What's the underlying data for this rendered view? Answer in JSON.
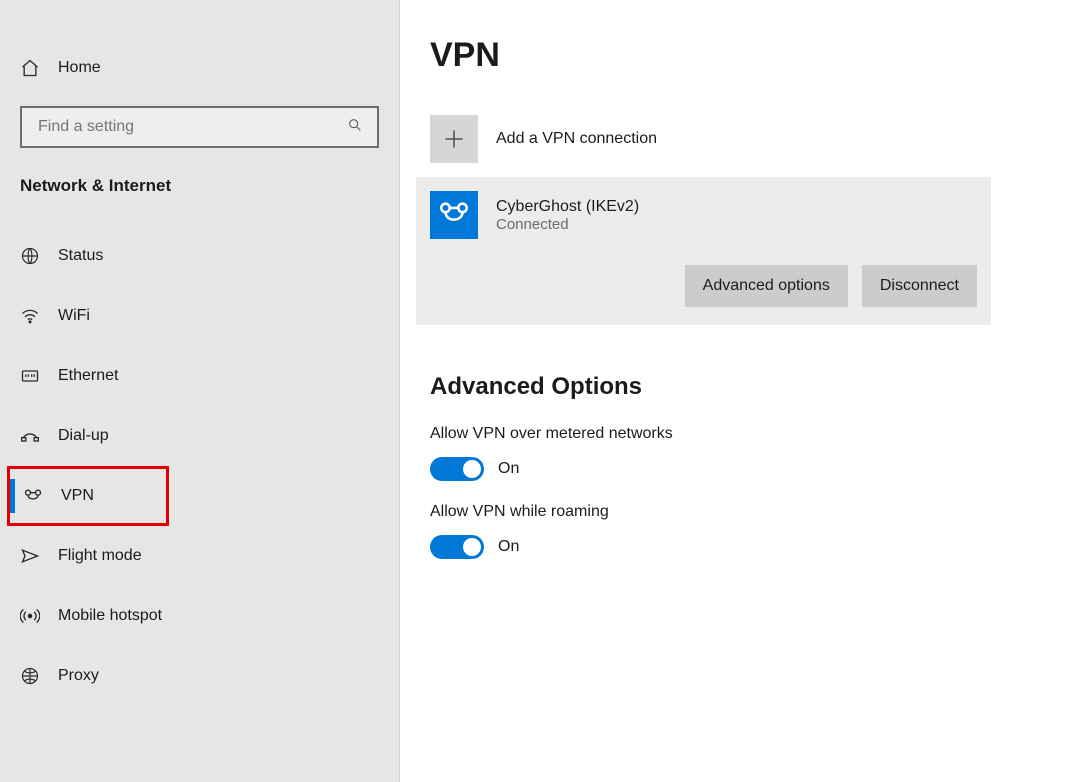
{
  "sidebar": {
    "home": "Home",
    "search_placeholder": "Find a setting",
    "category": "Network & Internet",
    "items": [
      {
        "label": "Status",
        "icon": "status"
      },
      {
        "label": "WiFi",
        "icon": "wifi"
      },
      {
        "label": "Ethernet",
        "icon": "ethernet"
      },
      {
        "label": "Dial-up",
        "icon": "dialup"
      },
      {
        "label": "VPN",
        "icon": "vpn",
        "active": true,
        "highlight": true
      },
      {
        "label": "Flight mode",
        "icon": "flight"
      },
      {
        "label": "Mobile hotspot",
        "icon": "hotspot"
      },
      {
        "label": "Proxy",
        "icon": "proxy"
      }
    ]
  },
  "page": {
    "title": "VPN",
    "add_label": "Add a VPN connection",
    "connection": {
      "name": "CyberGhost (IKEv2)",
      "status": "Connected"
    },
    "buttons": {
      "advanced": "Advanced options",
      "disconnect": "Disconnect"
    },
    "advanced_header": "Advanced Options",
    "option_metered": {
      "label": "Allow VPN over metered networks",
      "state": "On"
    },
    "option_roaming": {
      "label": "Allow VPN while roaming",
      "state": "On"
    }
  }
}
